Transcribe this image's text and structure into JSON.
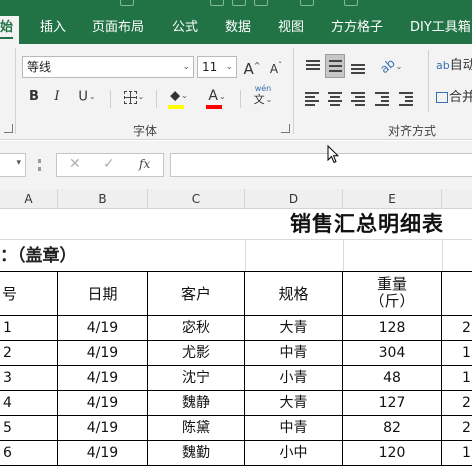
{
  "ribbon_tabs": [
    "始",
    "插入",
    "页面布局",
    "公式",
    "数据",
    "视图",
    "方方格子",
    "DIY工具箱"
  ],
  "font": {
    "name_value": "等线",
    "size_value": "11",
    "grow_label": "A",
    "shrink_label": "A",
    "bold_label": "B",
    "italic_label": "I",
    "underline_label": "U",
    "fill_label": "◆",
    "color_label": "A",
    "wen_label": "wén",
    "wen_char": "文",
    "group_label": "字体"
  },
  "alignment": {
    "group_label": "对齐方式",
    "wrap_label": "自动",
    "merge_label": "合并"
  },
  "formula_bar": {
    "cancel": "✕",
    "enter": "✓",
    "fx": "fx"
  },
  "columns": [
    "A",
    "B",
    "C",
    "D",
    "E"
  ],
  "sheet": {
    "title": "销售汇总明细表",
    "stamp": "：（盖章）",
    "headers": {
      "seq": "号",
      "date": "日期",
      "customer": "客户",
      "spec": "规格",
      "weight_line1": "重量",
      "weight_line2": "（斤）"
    },
    "rows": [
      {
        "seq": "1",
        "date": "4/19",
        "customer": "宓秋",
        "spec": "大青",
        "weight": "128",
        "next": "2"
      },
      {
        "seq": "2",
        "date": "4/19",
        "customer": "尤影",
        "spec": "中青",
        "weight": "304",
        "next": "1"
      },
      {
        "seq": "3",
        "date": "4/19",
        "customer": "沈宁",
        "spec": "小青",
        "weight": "48",
        "next": "1"
      },
      {
        "seq": "4",
        "date": "4/19",
        "customer": "魏静",
        "spec": "大青",
        "weight": "127",
        "next": "2"
      },
      {
        "seq": "5",
        "date": "4/19",
        "customer": "陈黛",
        "spec": "中青",
        "weight": "82",
        "next": "2"
      },
      {
        "seq": "6",
        "date": "4/19",
        "customer": "魏勤",
        "spec": "小中",
        "weight": "120",
        "next": "1"
      }
    ]
  },
  "colors": {
    "excel_green": "#217346",
    "fill_bar": "#ffff00",
    "font_color_bar": "#ff0000"
  }
}
